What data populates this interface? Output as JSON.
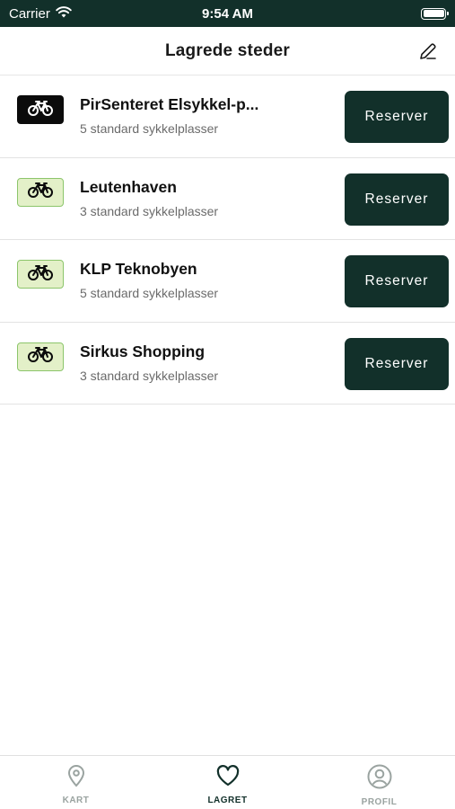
{
  "status_bar": {
    "carrier": "Carrier",
    "time": "9:54 AM"
  },
  "header": {
    "title": "Lagrede steder",
    "edit_icon": "pencil-icon"
  },
  "locations": [
    {
      "name": "PirSenteret Elsykkel-p...",
      "subtitle": "5 standard sykkelplasser",
      "badge_style": "dark",
      "action": "Reserver"
    },
    {
      "name": "Leutenhaven",
      "subtitle": "3 standard sykkelplasser",
      "badge_style": "light",
      "action": "Reserver"
    },
    {
      "name": "KLP Teknobyen",
      "subtitle": "5 standard sykkelplasser",
      "badge_style": "light",
      "action": "Reserver"
    },
    {
      "name": "Sirkus Shopping",
      "subtitle": "3 standard sykkelplasser",
      "badge_style": "light",
      "action": "Reserver"
    }
  ],
  "tabs": [
    {
      "label": "KART",
      "icon": "map-pin-icon",
      "active": false
    },
    {
      "label": "LAGRET",
      "icon": "heart-icon",
      "active": true
    },
    {
      "label": "PROFIL",
      "icon": "profile-icon",
      "active": false
    }
  ],
  "colors": {
    "primary": "#12302a",
    "badge_light_bg": "#e3f0c8",
    "badge_light_border": "#8cc56b",
    "badge_dark_bg": "#0b0b0b",
    "tab_inactive": "#9aa3a0"
  }
}
